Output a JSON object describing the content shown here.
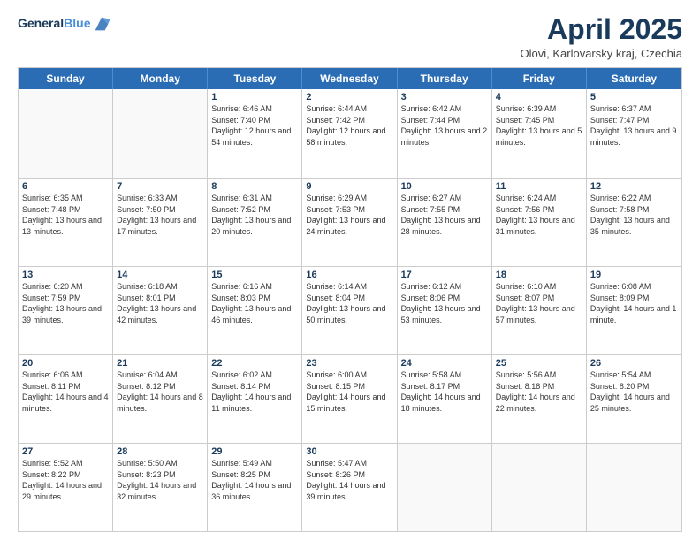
{
  "header": {
    "logo_line1": "General",
    "logo_line2": "Blue",
    "month_title": "April 2025",
    "location": "Olovi, Karlovarsky kraj, Czechia"
  },
  "days_of_week": [
    "Sunday",
    "Monday",
    "Tuesday",
    "Wednesday",
    "Thursday",
    "Friday",
    "Saturday"
  ],
  "weeks": [
    [
      {
        "day": "",
        "sunrise": "",
        "sunset": "",
        "daylight": ""
      },
      {
        "day": "",
        "sunrise": "",
        "sunset": "",
        "daylight": ""
      },
      {
        "day": "1",
        "sunrise": "Sunrise: 6:46 AM",
        "sunset": "Sunset: 7:40 PM",
        "daylight": "Daylight: 12 hours and 54 minutes."
      },
      {
        "day": "2",
        "sunrise": "Sunrise: 6:44 AM",
        "sunset": "Sunset: 7:42 PM",
        "daylight": "Daylight: 12 hours and 58 minutes."
      },
      {
        "day": "3",
        "sunrise": "Sunrise: 6:42 AM",
        "sunset": "Sunset: 7:44 PM",
        "daylight": "Daylight: 13 hours and 2 minutes."
      },
      {
        "day": "4",
        "sunrise": "Sunrise: 6:39 AM",
        "sunset": "Sunset: 7:45 PM",
        "daylight": "Daylight: 13 hours and 5 minutes."
      },
      {
        "day": "5",
        "sunrise": "Sunrise: 6:37 AM",
        "sunset": "Sunset: 7:47 PM",
        "daylight": "Daylight: 13 hours and 9 minutes."
      }
    ],
    [
      {
        "day": "6",
        "sunrise": "Sunrise: 6:35 AM",
        "sunset": "Sunset: 7:48 PM",
        "daylight": "Daylight: 13 hours and 13 minutes."
      },
      {
        "day": "7",
        "sunrise": "Sunrise: 6:33 AM",
        "sunset": "Sunset: 7:50 PM",
        "daylight": "Daylight: 13 hours and 17 minutes."
      },
      {
        "day": "8",
        "sunrise": "Sunrise: 6:31 AM",
        "sunset": "Sunset: 7:52 PM",
        "daylight": "Daylight: 13 hours and 20 minutes."
      },
      {
        "day": "9",
        "sunrise": "Sunrise: 6:29 AM",
        "sunset": "Sunset: 7:53 PM",
        "daylight": "Daylight: 13 hours and 24 minutes."
      },
      {
        "day": "10",
        "sunrise": "Sunrise: 6:27 AM",
        "sunset": "Sunset: 7:55 PM",
        "daylight": "Daylight: 13 hours and 28 minutes."
      },
      {
        "day": "11",
        "sunrise": "Sunrise: 6:24 AM",
        "sunset": "Sunset: 7:56 PM",
        "daylight": "Daylight: 13 hours and 31 minutes."
      },
      {
        "day": "12",
        "sunrise": "Sunrise: 6:22 AM",
        "sunset": "Sunset: 7:58 PM",
        "daylight": "Daylight: 13 hours and 35 minutes."
      }
    ],
    [
      {
        "day": "13",
        "sunrise": "Sunrise: 6:20 AM",
        "sunset": "Sunset: 7:59 PM",
        "daylight": "Daylight: 13 hours and 39 minutes."
      },
      {
        "day": "14",
        "sunrise": "Sunrise: 6:18 AM",
        "sunset": "Sunset: 8:01 PM",
        "daylight": "Daylight: 13 hours and 42 minutes."
      },
      {
        "day": "15",
        "sunrise": "Sunrise: 6:16 AM",
        "sunset": "Sunset: 8:03 PM",
        "daylight": "Daylight: 13 hours and 46 minutes."
      },
      {
        "day": "16",
        "sunrise": "Sunrise: 6:14 AM",
        "sunset": "Sunset: 8:04 PM",
        "daylight": "Daylight: 13 hours and 50 minutes."
      },
      {
        "day": "17",
        "sunrise": "Sunrise: 6:12 AM",
        "sunset": "Sunset: 8:06 PM",
        "daylight": "Daylight: 13 hours and 53 minutes."
      },
      {
        "day": "18",
        "sunrise": "Sunrise: 6:10 AM",
        "sunset": "Sunset: 8:07 PM",
        "daylight": "Daylight: 13 hours and 57 minutes."
      },
      {
        "day": "19",
        "sunrise": "Sunrise: 6:08 AM",
        "sunset": "Sunset: 8:09 PM",
        "daylight": "Daylight: 14 hours and 1 minute."
      }
    ],
    [
      {
        "day": "20",
        "sunrise": "Sunrise: 6:06 AM",
        "sunset": "Sunset: 8:11 PM",
        "daylight": "Daylight: 14 hours and 4 minutes."
      },
      {
        "day": "21",
        "sunrise": "Sunrise: 6:04 AM",
        "sunset": "Sunset: 8:12 PM",
        "daylight": "Daylight: 14 hours and 8 minutes."
      },
      {
        "day": "22",
        "sunrise": "Sunrise: 6:02 AM",
        "sunset": "Sunset: 8:14 PM",
        "daylight": "Daylight: 14 hours and 11 minutes."
      },
      {
        "day": "23",
        "sunrise": "Sunrise: 6:00 AM",
        "sunset": "Sunset: 8:15 PM",
        "daylight": "Daylight: 14 hours and 15 minutes."
      },
      {
        "day": "24",
        "sunrise": "Sunrise: 5:58 AM",
        "sunset": "Sunset: 8:17 PM",
        "daylight": "Daylight: 14 hours and 18 minutes."
      },
      {
        "day": "25",
        "sunrise": "Sunrise: 5:56 AM",
        "sunset": "Sunset: 8:18 PM",
        "daylight": "Daylight: 14 hours and 22 minutes."
      },
      {
        "day": "26",
        "sunrise": "Sunrise: 5:54 AM",
        "sunset": "Sunset: 8:20 PM",
        "daylight": "Daylight: 14 hours and 25 minutes."
      }
    ],
    [
      {
        "day": "27",
        "sunrise": "Sunrise: 5:52 AM",
        "sunset": "Sunset: 8:22 PM",
        "daylight": "Daylight: 14 hours and 29 minutes."
      },
      {
        "day": "28",
        "sunrise": "Sunrise: 5:50 AM",
        "sunset": "Sunset: 8:23 PM",
        "daylight": "Daylight: 14 hours and 32 minutes."
      },
      {
        "day": "29",
        "sunrise": "Sunrise: 5:49 AM",
        "sunset": "Sunset: 8:25 PM",
        "daylight": "Daylight: 14 hours and 36 minutes."
      },
      {
        "day": "30",
        "sunrise": "Sunrise: 5:47 AM",
        "sunset": "Sunset: 8:26 PM",
        "daylight": "Daylight: 14 hours and 39 minutes."
      },
      {
        "day": "",
        "sunrise": "",
        "sunset": "",
        "daylight": ""
      },
      {
        "day": "",
        "sunrise": "",
        "sunset": "",
        "daylight": ""
      },
      {
        "day": "",
        "sunrise": "",
        "sunset": "",
        "daylight": ""
      }
    ]
  ]
}
